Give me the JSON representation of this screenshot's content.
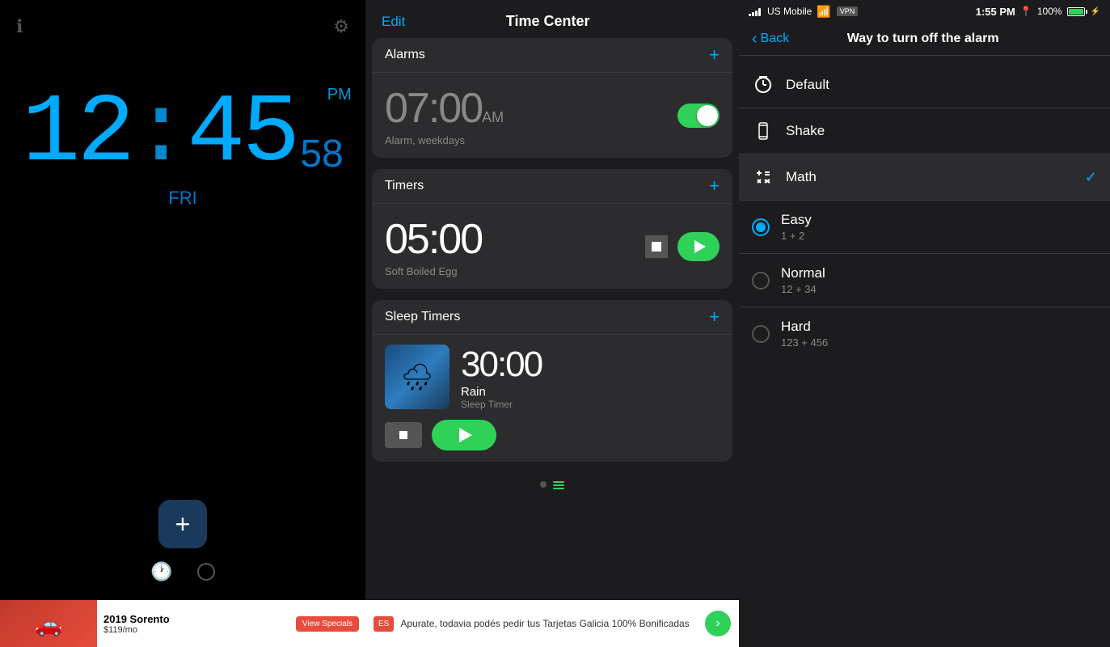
{
  "left": {
    "clock": {
      "hours": "12",
      "colon": ":",
      "minutes": "45",
      "seconds": "58",
      "ampm": "PM",
      "day": "FRI"
    },
    "info_icon": "ℹ",
    "settings_icon": "⚙",
    "add_label": "+",
    "ad": {
      "title": "2019 Sorento",
      "price": "$119/mo",
      "cta": "View Specials"
    }
  },
  "middle": {
    "title": "Time Center",
    "edit_label": "Edit",
    "sections": {
      "alarms": {
        "label": "Alarms",
        "alarm": {
          "time": "07:00",
          "ampm": "AM",
          "description": "Alarm, weekdays",
          "enabled": true
        }
      },
      "timers": {
        "label": "Timers",
        "timer": {
          "time": "05:00",
          "description": "Soft Boiled Egg"
        }
      },
      "sleep_timers": {
        "label": "Sleep Timers",
        "sleep": {
          "time": "30:00",
          "name": "Rain",
          "type": "Sleep Timer"
        }
      }
    },
    "dots": [
      {
        "type": "circle",
        "active": false
      },
      {
        "type": "lines",
        "active": true
      }
    ],
    "ad": {
      "flag": "ES",
      "text": "Apurate, todavia podés pedir tus Tarjetas Galicia 100% Bonificadas",
      "arrow": "›"
    }
  },
  "right": {
    "status": {
      "carrier": "US Mobile",
      "time": "1:55 PM",
      "battery_pct": "100%"
    },
    "back_label": "Back",
    "title": "Way to turn off the alarm",
    "items": [
      {
        "id": "default",
        "icon": "alarm",
        "title": "Default",
        "subtitle": "",
        "checked": false,
        "radio": false
      },
      {
        "id": "shake",
        "icon": "phone",
        "title": "Shake",
        "subtitle": "",
        "checked": false,
        "radio": false
      },
      {
        "id": "math",
        "icon": "math",
        "title": "Math",
        "subtitle": "",
        "checked": true,
        "radio": false,
        "highlight": true
      },
      {
        "id": "easy",
        "icon": "none",
        "title": "Easy",
        "subtitle": "1 + 2",
        "radio": true,
        "radio_checked": true
      },
      {
        "id": "normal",
        "icon": "none",
        "title": "Normal",
        "subtitle": "12 + 34",
        "radio": true,
        "radio_checked": false
      },
      {
        "id": "hard",
        "icon": "none",
        "title": "Hard",
        "subtitle": "123 + 456",
        "radio": true,
        "radio_checked": false
      }
    ]
  }
}
